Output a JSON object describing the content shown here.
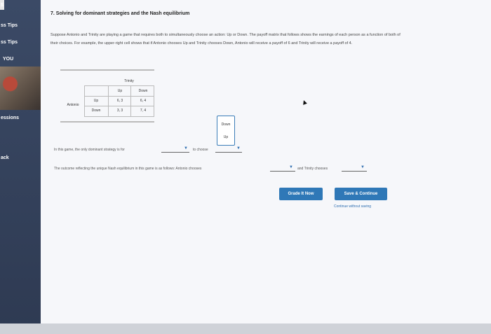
{
  "sidebar": {
    "items": [
      {
        "label": "$"
      },
      {
        "label": "ss Tips"
      },
      {
        "label": "ss Tips"
      },
      {
        "label": "YOU"
      },
      {
        "label": "essions"
      },
      {
        "label": "ack"
      }
    ]
  },
  "question": {
    "title": "7. Solving for dominant strategies and the Nash equilibrium",
    "paragraph": "Suppose Antonio and Trinity are playing a game that requires both to simultaneously choose an action: Up or Down. The payoff matrix that follows shows the earnings of each person as a function of both of their choices. For example, the upper-right cell shows that if Antonio chooses Up and Trinity chooses Down, Antonio will receive a payoff of 6 and Trinity will receive a payoff of 4."
  },
  "matrix": {
    "col_player": "Trinity",
    "row_player": "Antonio",
    "col_headers": [
      "Up",
      "Down"
    ],
    "row_headers": [
      "Up",
      "Down"
    ],
    "cells": [
      [
        "6, 3",
        "6, 4"
      ],
      [
        "3, 3",
        "7, 4"
      ]
    ]
  },
  "dropdown": {
    "options": [
      "Down",
      "Up"
    ]
  },
  "sentence1": {
    "prefix": "In this game, the only dominant strategy is for",
    "middle": "to choose"
  },
  "sentence2": {
    "prefix": "The outcome reflecting the unique Nash equilibrium in this game is as follows: Antonio chooses",
    "middle": "and Trinity chooses"
  },
  "buttons": {
    "grade": "Grade It Now",
    "save": "Save & Continue",
    "continue_link": "Continue without saving"
  },
  "colors": {
    "accent": "#2f78b7",
    "sidebar": "#3b4a66"
  }
}
